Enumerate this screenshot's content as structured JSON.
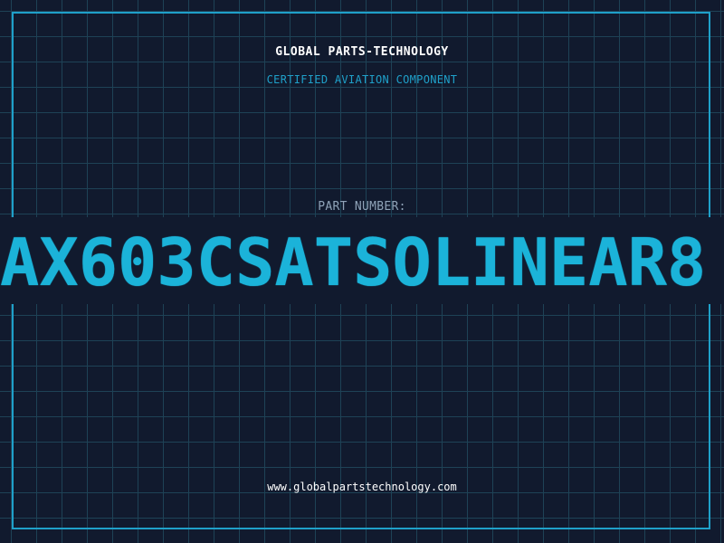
{
  "header": {
    "brand": "GLOBAL PARTS-TECHNOLOGY",
    "certification": "CERTIFIED AVIATION COMPONENT"
  },
  "part": {
    "label": "PART NUMBER:",
    "number": "AX603CSATSOLINEAR8"
  },
  "footer": {
    "website": "www.globalpartstechnology.com"
  },
  "colors": {
    "background": "#111a2e",
    "grid": "#1e4256",
    "accent": "#1fa0c9",
    "part_number": "#1bb3d9"
  }
}
